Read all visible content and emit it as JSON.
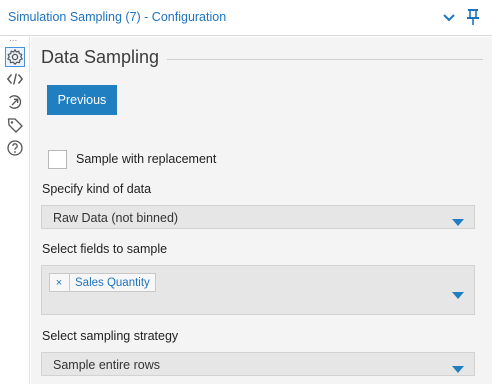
{
  "window": {
    "title": "Simulation Sampling (7) - Configuration",
    "collapse_icon": "chevron-down-icon",
    "pin_icon": "pin-icon"
  },
  "sidebar": {
    "more_label": "...",
    "items": [
      {
        "name": "configuration",
        "icon": "gear-icon",
        "active": true
      },
      {
        "name": "xml-view",
        "icon": "code-icon",
        "active": false
      },
      {
        "name": "annotation",
        "icon": "annotation-icon",
        "active": false
      },
      {
        "name": "metadata",
        "icon": "tag-icon",
        "active": false
      },
      {
        "name": "help",
        "icon": "help-icon",
        "active": false
      }
    ]
  },
  "panel": {
    "title": "Data Sampling",
    "previous_button": "Previous",
    "replacement": {
      "label": "Sample with replacement",
      "checked": false
    },
    "kind_of_data": {
      "label": "Specify kind of data",
      "value": "Raw Data (not binned)"
    },
    "fields": {
      "label": "Select fields to sample",
      "selected": [
        "Sales Quantity"
      ],
      "remove_glyph": "×"
    },
    "strategy": {
      "label": "Select sampling strategy",
      "value": "Sample entire rows"
    }
  },
  "colors": {
    "accent": "#1f7fc0",
    "link_text": "#1e73be",
    "panel_bg": "#f4f4f4",
    "input_bg": "#e6e6e6"
  }
}
